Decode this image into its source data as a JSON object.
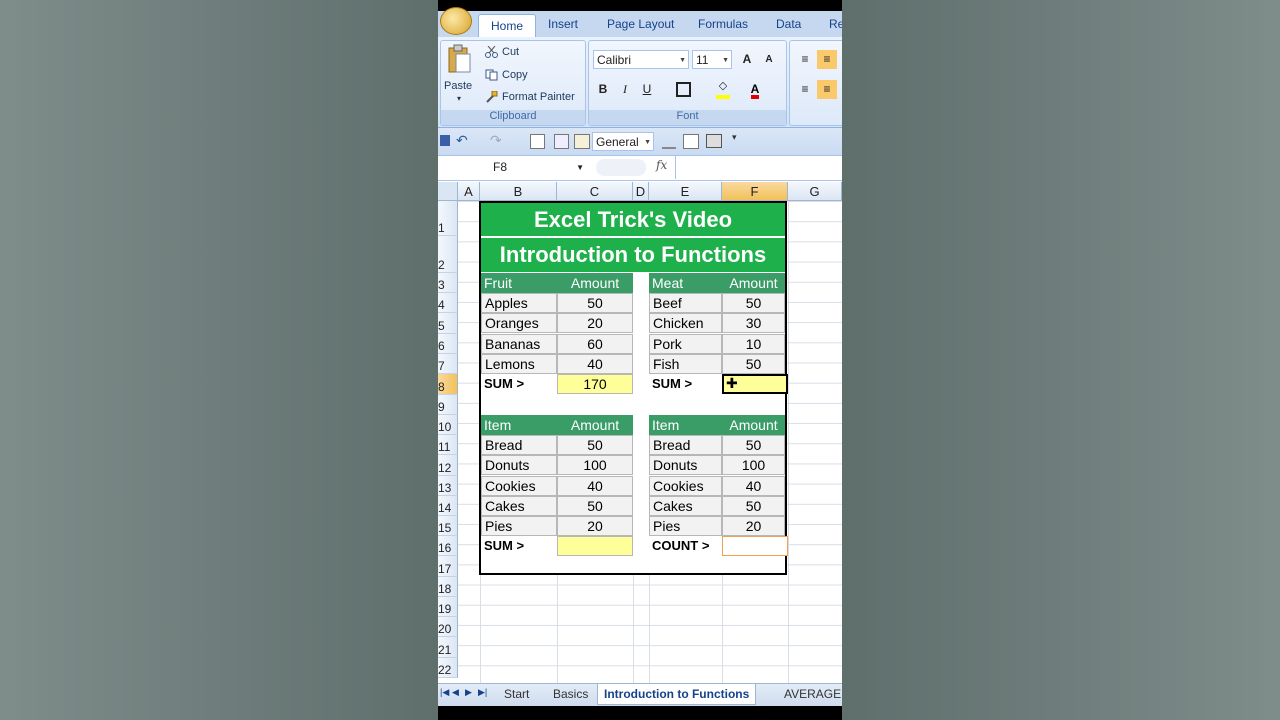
{
  "ribbon": {
    "tabs": [
      "Home",
      "Insert",
      "Page Layout",
      "Formulas",
      "Data",
      "Re"
    ],
    "active_tab": "Home",
    "clipboard": {
      "paste": "Paste",
      "cut": "Cut",
      "copy": "Copy",
      "format_painter": "Format Painter",
      "group_label": "Clipboard"
    },
    "font": {
      "name": "Calibri",
      "size": "11",
      "bold": "B",
      "italic": "I",
      "underline": "U",
      "grow": "A",
      "shrink": "A",
      "group_label": "Font"
    }
  },
  "qat": {
    "number_format": "General"
  },
  "formula_bar": {
    "name_box": "F8",
    "fx": "fx",
    "formula": ""
  },
  "columns": [
    "A",
    "B",
    "C",
    "D",
    "E",
    "F",
    "G"
  ],
  "selected_column": "F",
  "rows": [
    "1",
    "2",
    "3",
    "4",
    "5",
    "6",
    "7",
    "8",
    "9",
    "10",
    "11",
    "12",
    "13",
    "14",
    "15",
    "16",
    "17",
    "18",
    "19",
    "20",
    "21",
    "22"
  ],
  "selected_row": "8",
  "sheet": {
    "title1": "Excel Trick's Video",
    "title2": "Introduction to Functions",
    "tables": [
      {
        "header": [
          "Fruit",
          "Amount"
        ],
        "rows": [
          [
            "Apples",
            "50"
          ],
          [
            "Oranges",
            "20"
          ],
          [
            "Bananas",
            "60"
          ],
          [
            "Lemons",
            "40"
          ]
        ],
        "sum_label": "SUM >",
        "sum_value": "170"
      },
      {
        "header": [
          "Meat",
          "Amount"
        ],
        "rows": [
          [
            "Beef",
            "50"
          ],
          [
            "Chicken",
            "30"
          ],
          [
            "Pork",
            "10"
          ],
          [
            "Fish",
            "50"
          ]
        ],
        "sum_label": "SUM >",
        "sum_value": ""
      },
      {
        "header": [
          "Item",
          "Amount"
        ],
        "rows": [
          [
            "Bread",
            "50"
          ],
          [
            "Donuts",
            "100"
          ],
          [
            "Cookies",
            "40"
          ],
          [
            "Cakes",
            "50"
          ],
          [
            "Pies",
            "20"
          ]
        ],
        "sum_label": "SUM >",
        "sum_value": ""
      },
      {
        "header": [
          "Item",
          "Amount"
        ],
        "rows": [
          [
            "Bread",
            "50"
          ],
          [
            "Donuts",
            "100"
          ],
          [
            "Cookies",
            "40"
          ],
          [
            "Cakes",
            "50"
          ],
          [
            "Pies",
            "20"
          ]
        ],
        "sum_label": "COUNT >",
        "sum_value": ""
      }
    ]
  },
  "sheet_tabs": [
    "Start",
    "Basics",
    "Introduction to Functions",
    "AVERAGE"
  ],
  "active_sheet": "Introduction to Functions",
  "colors": {
    "banner": "#1eb04a",
    "table_header": "#3a9c67",
    "highlight": "#ffff99",
    "selection": "#f1c15a"
  }
}
